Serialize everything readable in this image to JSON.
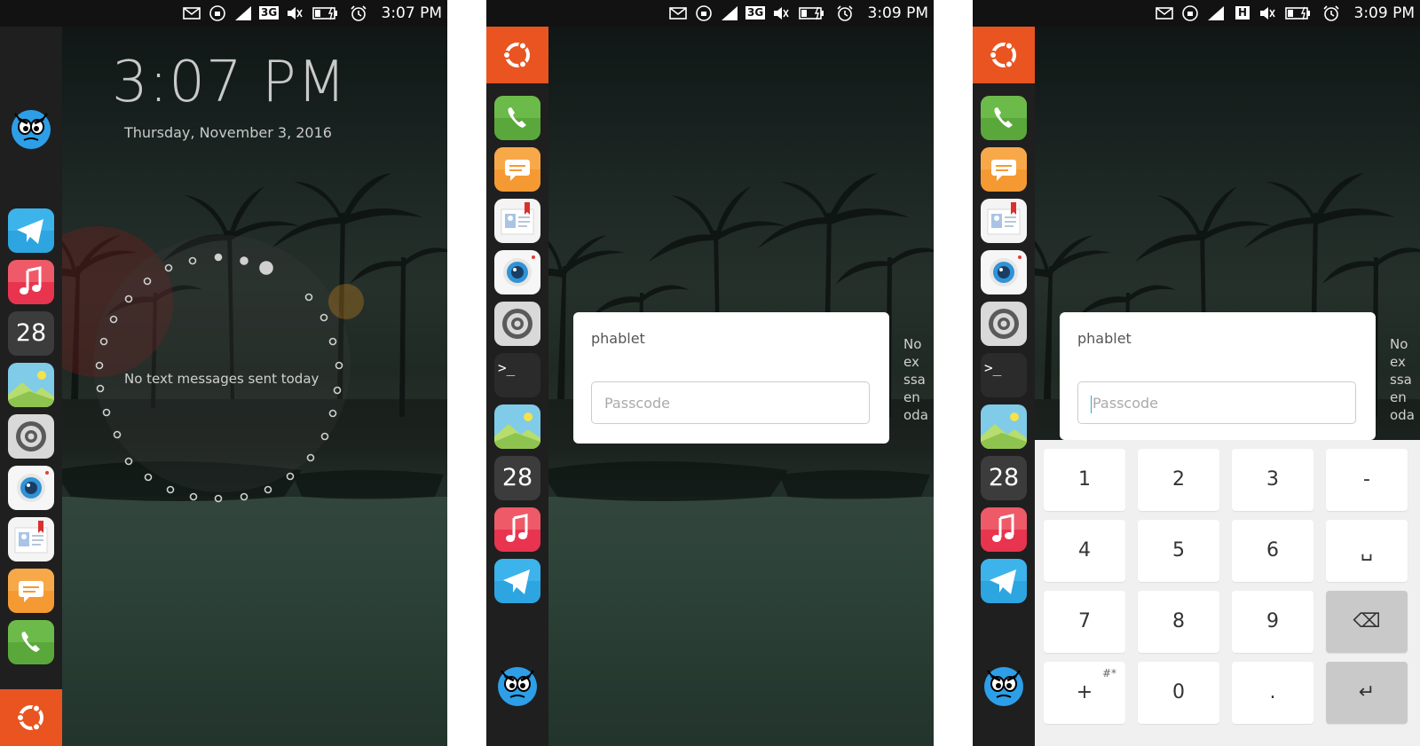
{
  "colors": {
    "accent": "#e95420",
    "launcher": "#1f1f1f",
    "dialog": "#ffffff",
    "keyboard": "#f0f0f0",
    "caret": "#2fa2e8"
  },
  "screens": [
    {
      "statusbar": {
        "icons": [
          "mail-icon",
          "orientation-lock-icon",
          "signal-icon",
          "network-3g-icon",
          "volume-muted-icon",
          "battery-charging-icon",
          "alarm-icon"
        ],
        "network": "3G",
        "time": "3:07 PM"
      },
      "lock": {
        "time": "3:07 PM",
        "date": "Thursday, November 3, 2016",
        "infographic_text": "No text messages sent today"
      },
      "launcher": [
        "Telegram",
        "Music",
        "Calendar",
        "Gallery",
        "System Settings",
        "Camera",
        "Contacts",
        "Messaging",
        "Phone"
      ],
      "calendar_day": "28"
    },
    {
      "statusbar": {
        "network": "3G",
        "time": "3:09 PM"
      },
      "launcher": [
        "Phone",
        "Messaging",
        "Contacts",
        "Camera",
        "System Settings",
        "Terminal",
        "Gallery",
        "Calendar",
        "Music",
        "Telegram"
      ],
      "calendar_day": "28",
      "terminal_glyph": ">_",
      "dialog": {
        "username": "phablet",
        "passcode_placeholder": "Passcode"
      },
      "side_text": [
        "No",
        "ex",
        "ssa",
        "en",
        "oda"
      ]
    },
    {
      "statusbar": {
        "network": "H",
        "time": "3:09 PM"
      },
      "launcher": [
        "Phone",
        "Messaging",
        "Contacts",
        "Camera",
        "System Settings",
        "Terminal",
        "Gallery",
        "Calendar",
        "Music",
        "Telegram"
      ],
      "calendar_day": "28",
      "terminal_glyph": ">_",
      "dialog": {
        "username": "phablet",
        "passcode_placeholder": "Passcode"
      },
      "side_text": [
        "No",
        "ex",
        "ssa",
        "en",
        "oda"
      ],
      "keyboard": {
        "rows": [
          [
            "1",
            "2",
            "3",
            "-"
          ],
          [
            "4",
            "5",
            "6",
            "␣"
          ],
          [
            "7",
            "8",
            "9",
            "⌫"
          ],
          [
            "+",
            "0",
            ".",
            "↵"
          ]
        ],
        "plus_superscript": "#*"
      }
    }
  ]
}
